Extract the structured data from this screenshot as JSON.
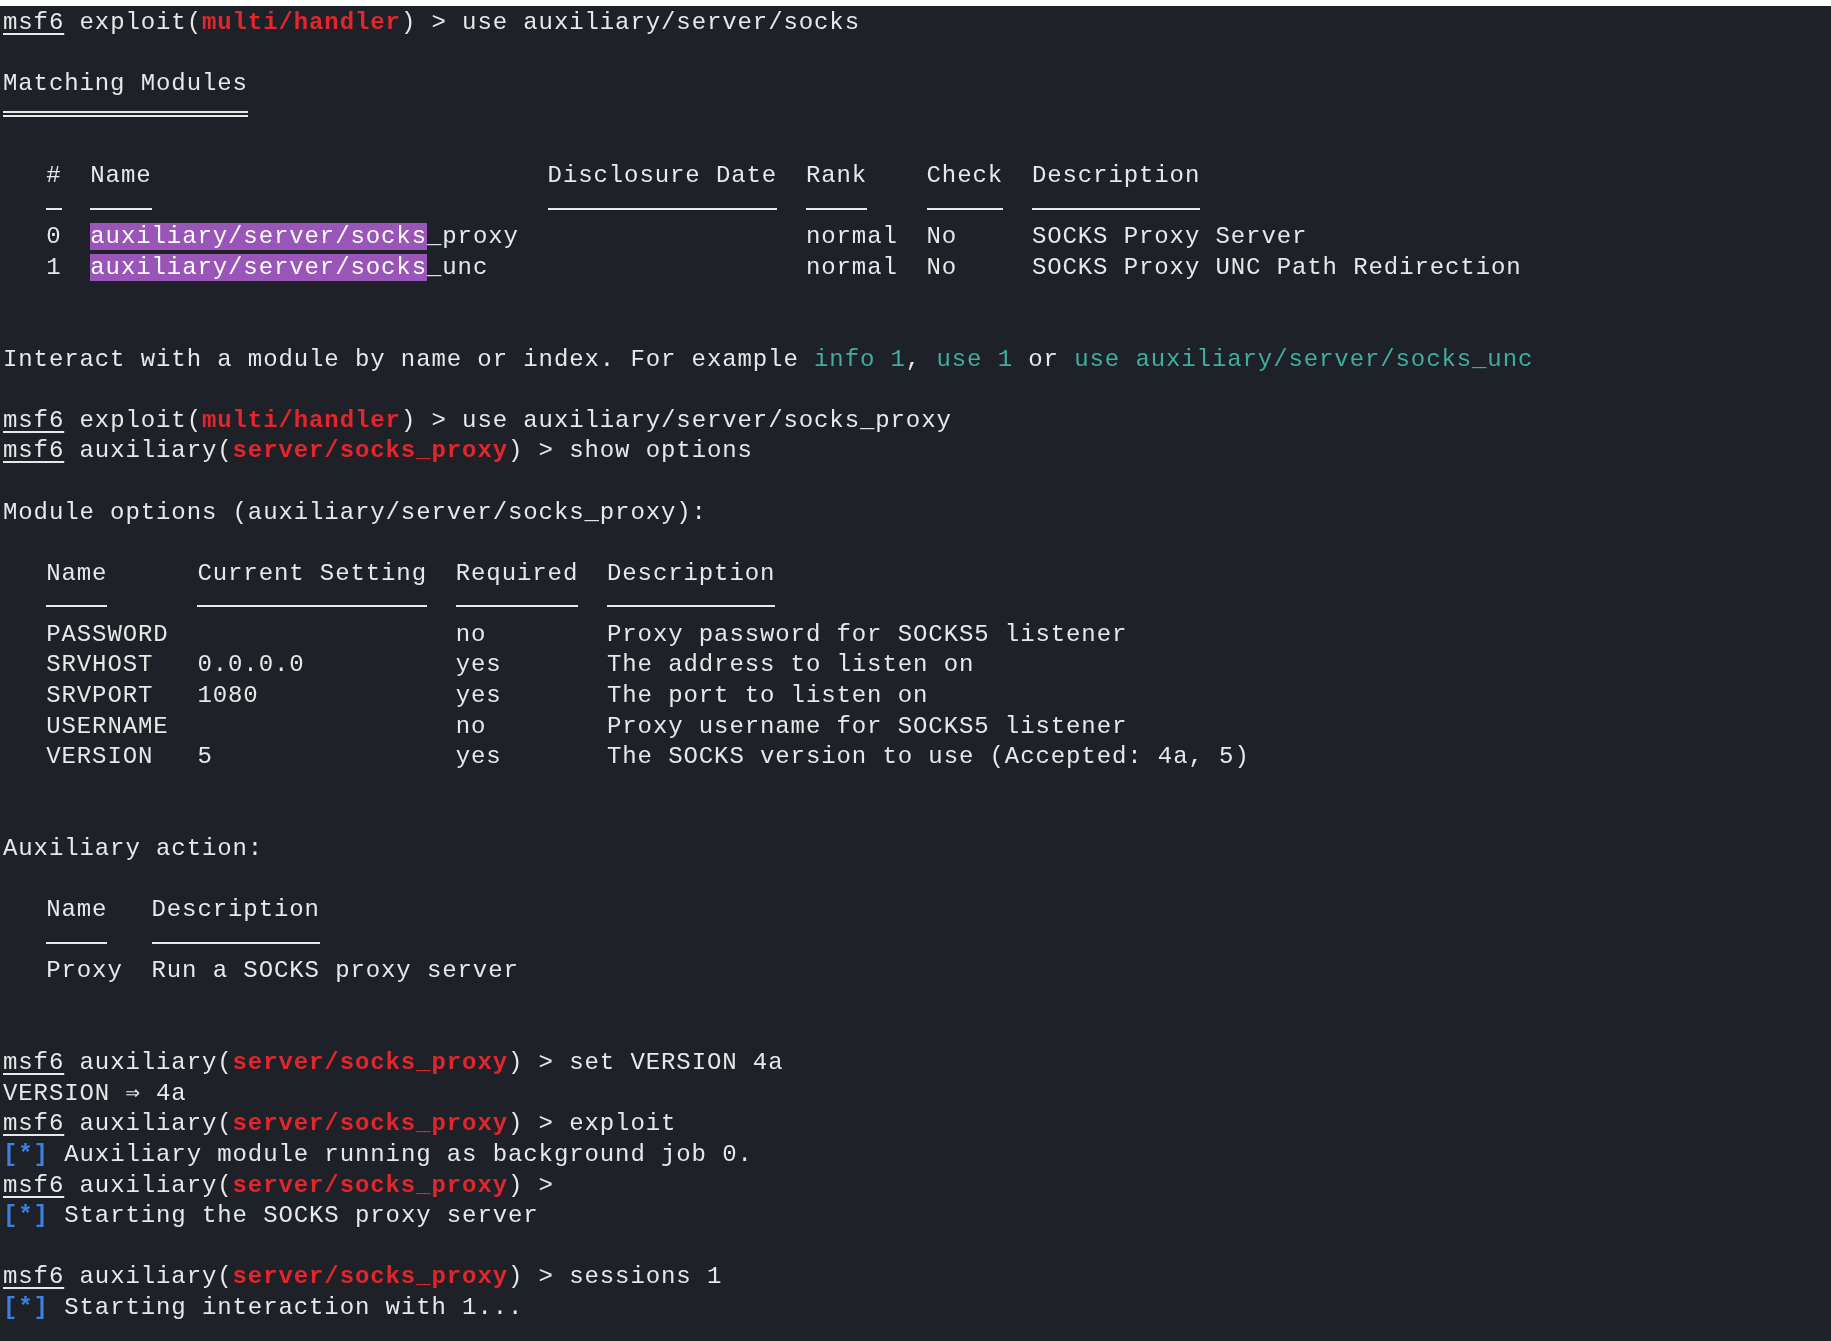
{
  "lines": [
    {
      "kind": "text",
      "segments": [
        {
          "kind": "underline",
          "text": "msf6"
        },
        {
          "kind": "plain",
          "text": " exploit("
        },
        {
          "kind": "red",
          "text": "multi/handler"
        },
        {
          "kind": "plain",
          "text": ") > use auxiliary/server/socks"
        }
      ]
    },
    {
      "kind": "blank"
    },
    {
      "kind": "heading",
      "text": "Matching Modules"
    },
    {
      "kind": "blank"
    },
    {
      "kind": "table",
      "columns": [
        "#",
        "Name",
        "Disclosure Date",
        "Rank",
        "Check",
        "Description"
      ],
      "rows": [
        [
          "0",
          [
            {
              "kind": "match",
              "text": "auxiliary/server/socks"
            },
            {
              "kind": "plain",
              "text": "_proxy"
            }
          ],
          "",
          "normal",
          "No",
          "SOCKS Proxy Server"
        ],
        [
          "1",
          [
            {
              "kind": "match",
              "text": "auxiliary/server/socks"
            },
            {
              "kind": "plain",
              "text": "_unc"
            }
          ],
          "",
          "normal",
          "No",
          "SOCKS Proxy UNC Path Redirection"
        ]
      ]
    },
    {
      "kind": "blank"
    },
    {
      "kind": "blank"
    },
    {
      "kind": "text",
      "segments": [
        {
          "kind": "plain",
          "text": "Interact with a module by name or index. For example "
        },
        {
          "kind": "link",
          "text": "info 1"
        },
        {
          "kind": "plain",
          "text": ", "
        },
        {
          "kind": "link",
          "text": "use 1"
        },
        {
          "kind": "plain",
          "text": " or "
        },
        {
          "kind": "link",
          "text": "use auxiliary/server/socks_unc"
        }
      ]
    },
    {
      "kind": "blank"
    },
    {
      "kind": "text",
      "segments": [
        {
          "kind": "underline",
          "text": "msf6"
        },
        {
          "kind": "plain",
          "text": " exploit("
        },
        {
          "kind": "red",
          "text": "multi/handler"
        },
        {
          "kind": "plain",
          "text": ") > use auxiliary/server/socks_proxy"
        }
      ]
    },
    {
      "kind": "text",
      "segments": [
        {
          "kind": "underline",
          "text": "msf6"
        },
        {
          "kind": "plain",
          "text": " auxiliary("
        },
        {
          "kind": "red",
          "text": "server/socks_proxy"
        },
        {
          "kind": "plain",
          "text": ") > show options"
        }
      ]
    },
    {
      "kind": "blank"
    },
    {
      "kind": "text",
      "segments": [
        {
          "kind": "plain",
          "text": "Module options (auxiliary/server/socks_proxy):"
        }
      ]
    },
    {
      "kind": "blank"
    },
    {
      "kind": "table",
      "columns": [
        "Name",
        "Current Setting",
        "Required",
        "Description"
      ],
      "rows": [
        [
          "PASSWORD",
          "",
          "no",
          "Proxy password for SOCKS5 listener"
        ],
        [
          "SRVHOST",
          "0.0.0.0",
          "yes",
          "The address to listen on"
        ],
        [
          "SRVPORT",
          "1080",
          "yes",
          "The port to listen on"
        ],
        [
          "USERNAME",
          "",
          "no",
          "Proxy username for SOCKS5 listener"
        ],
        [
          "VERSION",
          "5",
          "yes",
          "The SOCKS version to use (Accepted: 4a, 5)"
        ]
      ]
    },
    {
      "kind": "blank"
    },
    {
      "kind": "blank"
    },
    {
      "kind": "text",
      "segments": [
        {
          "kind": "plain",
          "text": "Auxiliary action:"
        }
      ]
    },
    {
      "kind": "blank"
    },
    {
      "kind": "table",
      "columns": [
        "Name",
        "Description"
      ],
      "rows": [
        [
          "Proxy",
          "Run a SOCKS proxy server"
        ]
      ]
    },
    {
      "kind": "blank"
    },
    {
      "kind": "blank"
    },
    {
      "kind": "text",
      "segments": [
        {
          "kind": "underline",
          "text": "msf6"
        },
        {
          "kind": "plain",
          "text": " auxiliary("
        },
        {
          "kind": "red",
          "text": "server/socks_proxy"
        },
        {
          "kind": "plain",
          "text": ") > set VERSION 4a"
        }
      ]
    },
    {
      "kind": "text",
      "segments": [
        {
          "kind": "plain",
          "text": "VERSION ⇒ 4a"
        }
      ]
    },
    {
      "kind": "text",
      "segments": [
        {
          "kind": "underline",
          "text": "msf6"
        },
        {
          "kind": "plain",
          "text": " auxiliary("
        },
        {
          "kind": "red",
          "text": "server/socks_proxy"
        },
        {
          "kind": "plain",
          "text": ") > exploit"
        }
      ]
    },
    {
      "kind": "text",
      "segments": [
        {
          "kind": "star",
          "text": "[*]"
        },
        {
          "kind": "plain",
          "text": " Auxiliary module running as background job 0."
        }
      ]
    },
    {
      "kind": "text",
      "segments": [
        {
          "kind": "underline",
          "text": "msf6"
        },
        {
          "kind": "plain",
          "text": " auxiliary("
        },
        {
          "kind": "red",
          "text": "server/socks_proxy"
        },
        {
          "kind": "plain",
          "text": ") >"
        }
      ]
    },
    {
      "kind": "text",
      "segments": [
        {
          "kind": "star",
          "text": "[*]"
        },
        {
          "kind": "plain",
          "text": " Starting the SOCKS proxy server"
        }
      ]
    },
    {
      "kind": "blank"
    },
    {
      "kind": "text",
      "segments": [
        {
          "kind": "underline",
          "text": "msf6"
        },
        {
          "kind": "plain",
          "text": " auxiliary("
        },
        {
          "kind": "red",
          "text": "server/socks_proxy"
        },
        {
          "kind": "plain",
          "text": ") > sessions 1"
        }
      ]
    },
    {
      "kind": "text",
      "segments": [
        {
          "kind": "star",
          "text": "[*]"
        },
        {
          "kind": "plain",
          "text": " Starting interaction with 1..."
        }
      ]
    }
  ]
}
